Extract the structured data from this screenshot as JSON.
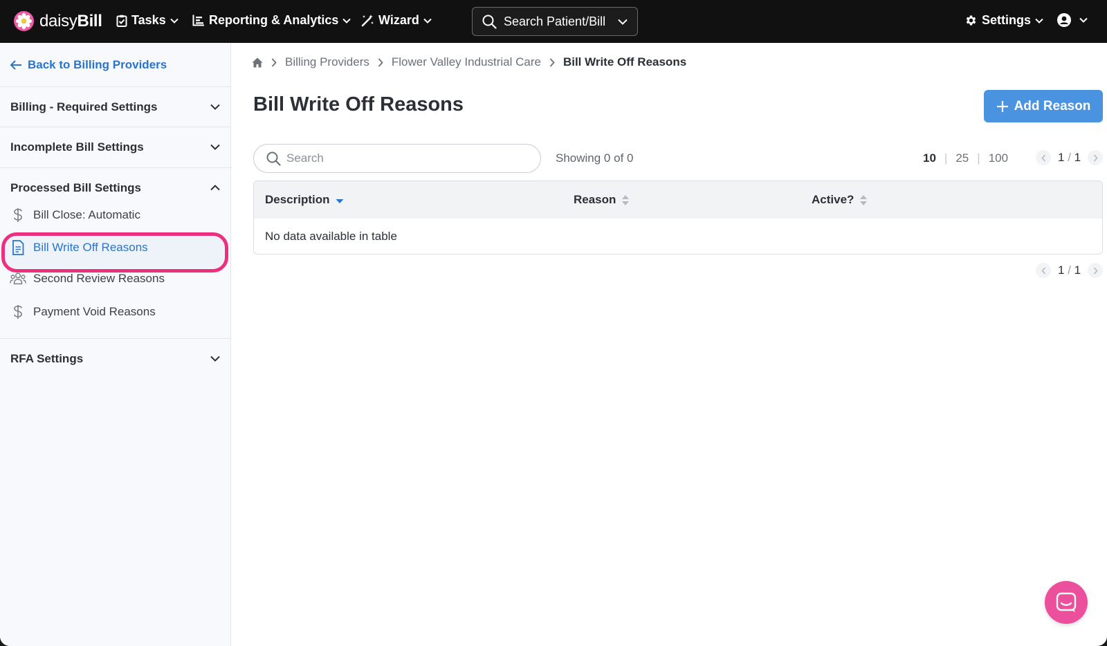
{
  "app": {
    "brand_light": "daisy",
    "brand_bold": "Bill"
  },
  "topnav": {
    "tasks": "Tasks",
    "reporting": "Reporting & Analytics",
    "wizard": "Wizard",
    "search_placeholder": "Search Patient/Bill",
    "settings": "Settings"
  },
  "sidebar": {
    "back_label": "Back to Billing Providers",
    "sections": [
      {
        "label": "Billing - Required Settings",
        "expanded": false
      },
      {
        "label": "Incomplete Bill Settings",
        "expanded": false
      },
      {
        "label": "Processed Bill Settings",
        "expanded": true
      },
      {
        "label": "RFA Settings",
        "expanded": false
      }
    ],
    "items": [
      {
        "label": "Bill Close: Automatic",
        "icon": "dollar-icon"
      },
      {
        "label": "Bill Write Off Reasons",
        "icon": "document-icon",
        "active": true
      },
      {
        "label": "Second Review Reasons",
        "icon": "users-icon"
      },
      {
        "label": "Payment Void Reasons",
        "icon": "dollar-icon"
      }
    ]
  },
  "breadcrumb": [
    "Billing Providers",
    "Flower Valley Industrial Care",
    "Bill Write Off Reasons"
  ],
  "page": {
    "title": "Bill Write Off Reasons",
    "add_button": "Add Reason"
  },
  "table": {
    "search_placeholder": "Search",
    "showing": "Showing 0 of 0",
    "page_sizes": [
      "10",
      "25",
      "100"
    ],
    "selected_page_size": "10",
    "page_current": "1",
    "page_total": "1",
    "columns": [
      "Description",
      "Reason",
      "Active?"
    ],
    "empty_message": "No data available in table"
  },
  "colors": {
    "accent": "#2a74c9",
    "button": "#4a93e0",
    "highlight": "#ec2f7e",
    "chat": "#ec4f9c",
    "topbar": "#111111"
  }
}
